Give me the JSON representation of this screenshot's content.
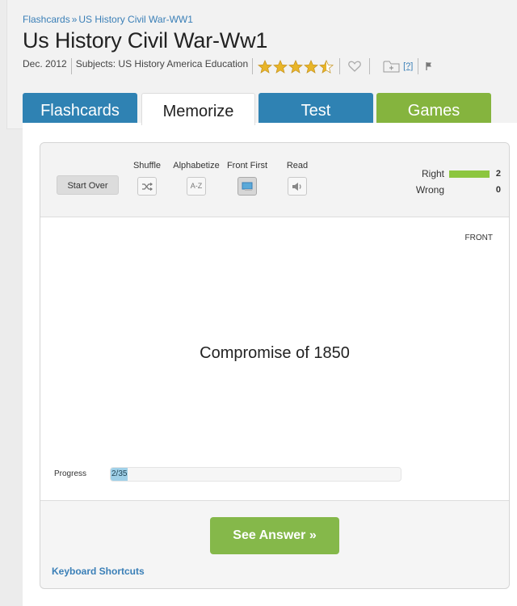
{
  "breadcrumb": {
    "items": [
      "Flashcards",
      "US History Civil War-WW1"
    ],
    "separator": "»"
  },
  "title": "Us History Civil War-Ww1",
  "meta": {
    "date": "Dec. 2012",
    "subjects": "Subjects: US History America Education",
    "rating": 4.5,
    "rating_max": 5,
    "help_label": "[?]"
  },
  "tabs": [
    {
      "label": "Flashcards",
      "active": false,
      "color": "#2f82b3"
    },
    {
      "label": "Memorize",
      "active": true,
      "color": "#ffffff"
    },
    {
      "label": "Test",
      "active": false,
      "color": "#2f82b3"
    },
    {
      "label": "Games",
      "active": false,
      "color": "#85b43e"
    }
  ],
  "toolbar": {
    "start_over": "Start Over",
    "shuffle": "Shuffle",
    "alphabetize": "Alphabetize",
    "alphabetize_icon_text": "A-Z",
    "front_first": "Front First",
    "read": "Read"
  },
  "score": {
    "right_label": "Right",
    "right_value": "2",
    "wrong_label": "Wrong",
    "wrong_value": "0"
  },
  "card": {
    "side": "FRONT",
    "term": "Compromise of 1850"
  },
  "progress": {
    "label": "Progress",
    "text": "2/35",
    "current": 2,
    "total": 35
  },
  "see_answer": "See Answer »",
  "keyboard_shortcuts": "Keyboard Shortcuts",
  "colors": {
    "link": "#3a7fb7",
    "accent_green": "#85b84a",
    "accent_blue": "#2f82b3",
    "right_bar": "#8cc63f",
    "progress_fill": "#9fd0e8"
  }
}
